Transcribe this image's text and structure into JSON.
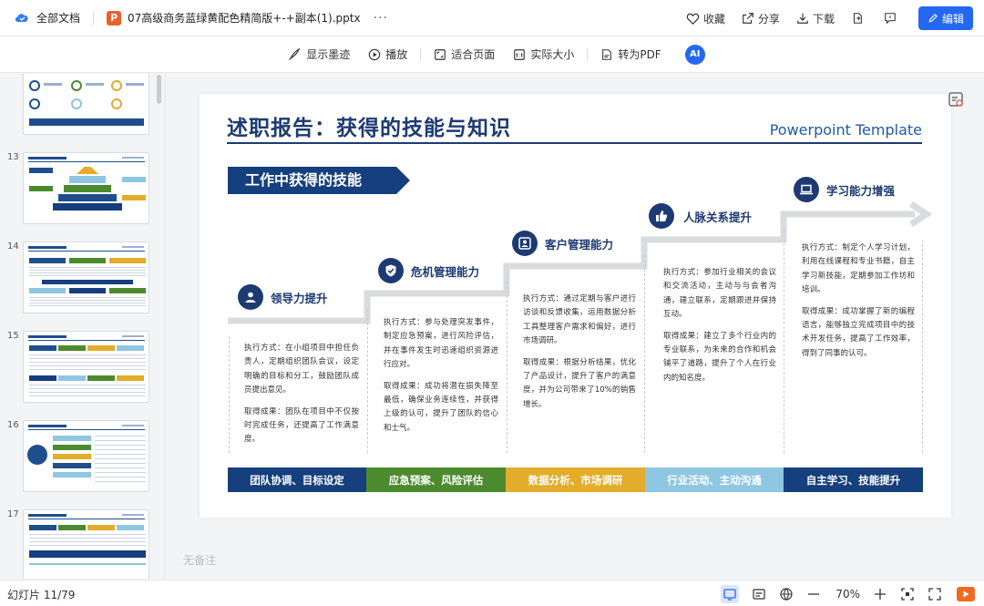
{
  "topbar": {
    "all_docs": "全部文档",
    "file_badge": "P",
    "filename": "07高级商务蓝绿黄配色精简版+-+副本(1).pptx",
    "more": "···",
    "collect": "收藏",
    "share": "分享",
    "download": "下载",
    "edit": "编辑"
  },
  "toolbar": {
    "ink": "显示墨迹",
    "play": "播放",
    "fit": "适合页面",
    "actual": "实际大小",
    "pdf": "转为PDF",
    "ai": "AI"
  },
  "sidebar": {
    "thumbs": [
      {
        "num": "",
        "accent": "#1f4e8c"
      },
      {
        "num": "13",
        "accent": "#1f4e8c"
      },
      {
        "num": "14",
        "accent": "#1f4e8c"
      },
      {
        "num": "15",
        "accent": "#1f4e8c"
      },
      {
        "num": "16",
        "accent": "#1f4e8c"
      },
      {
        "num": "17",
        "accent": "#1f4e8c"
      }
    ]
  },
  "slide": {
    "title": "述职报告：获得的技能与知识",
    "subtitle": "Powerpoint Template",
    "banner": "工作中获得的技能",
    "steps": [
      {
        "label": "领导力提升",
        "icon": "person-icon",
        "method": "执行方式：在小组项目中担任负责人，定期组织团队会议，设定明确的目标和分工，鼓励团队成员提出意见。",
        "result": "取得成果：团队在项目中不仅按时完成任务，还提高了工作满意度。",
        "bar_text": "团队协调、目标设定",
        "bar_color": "#153f7d"
      },
      {
        "label": "危机管理能力",
        "icon": "shield-check-icon",
        "method": "执行方式：参与处理突发事件，制定应急预案，进行风险评估，并在事件发生时迅速组织资源进行应对。",
        "result": "取得成果：成功将潜在损失降至最低，确保业务连续性，并获得上级的认可，提升了团队的信心和士气。",
        "bar_text": "应急预案、风险评估",
        "bar_color": "#4c8a2e"
      },
      {
        "label": "客户管理能力",
        "icon": "id-card-icon",
        "method": "执行方式：通过定期与客户进行访谈和反馈收集，运用数据分析工具整理客户需求和偏好，进行市场调研。",
        "result": "取得成果：根据分析结果，优化了产品设计，提升了客户的满意度，并为公司带来了10%的销售增长。",
        "bar_text": "数据分析、市场调研",
        "bar_color": "#e3ac2a"
      },
      {
        "label": "人脉关系提升",
        "icon": "thumbs-up-icon",
        "method": "执行方式：参加行业相关的会议和交流活动，主动与与会者沟通，建立联系，定期跟进并保持互动。",
        "result": "取得成果：建立了多个行业内的专业联系，为未来的合作和机会铺平了道路，提升了个人在行业内的知名度。",
        "bar_text": "行业活动、主动沟通",
        "bar_color": "#8fc6e2"
      },
      {
        "label": "学习能力增强",
        "icon": "laptop-icon",
        "method": "执行方式：制定个人学习计划，利用在线课程和专业书籍，自主学习新技能，定期参加工作坊和培训。",
        "result": "取得成果：成功掌握了新的编程语言，能够独立完成项目中的技术开发任务，提高了工作效率，得到了同事的认可。",
        "bar_text": "自主学习、技能提升",
        "bar_color": "#153f7d"
      }
    ]
  },
  "notes": "无备注",
  "status": {
    "slide_count": "幻灯片 11/79",
    "zoom": "70%"
  }
}
